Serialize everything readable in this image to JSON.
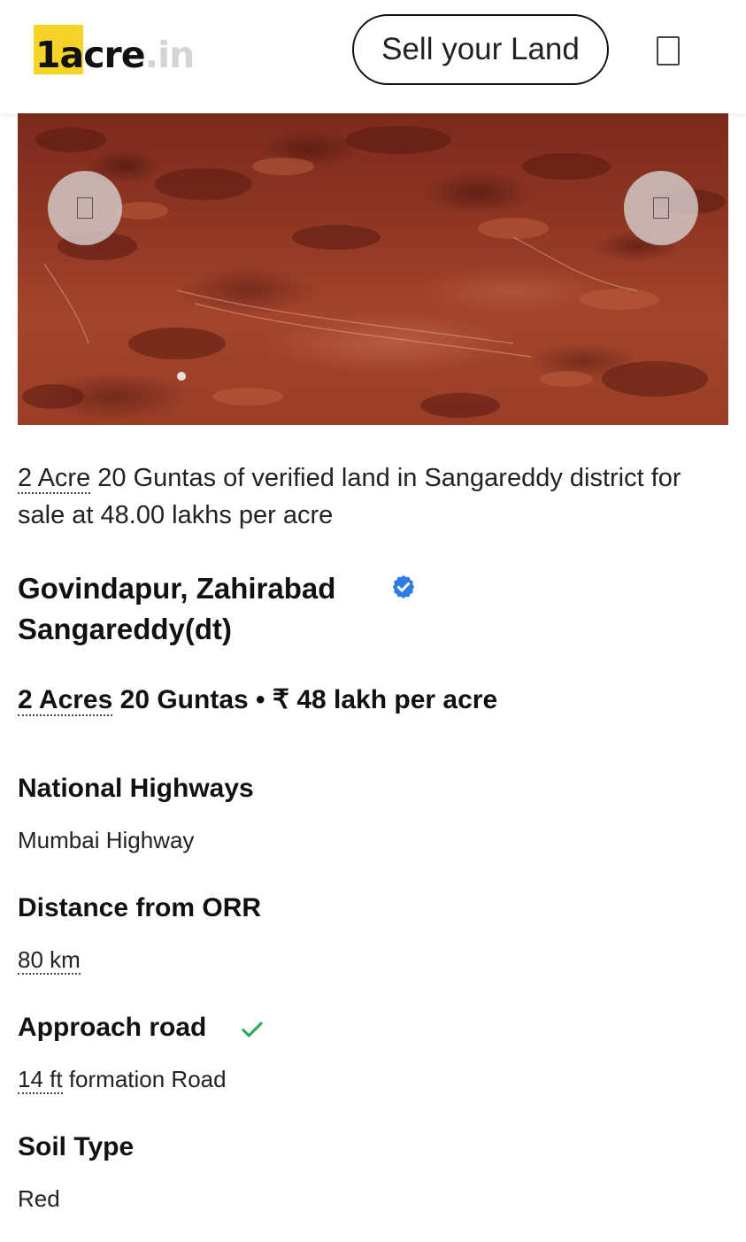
{
  "header": {
    "logo_main": "1acre",
    "logo_tld": ".in",
    "sell_button_label": "Sell your Land",
    "menu_icon": "menu-icon"
  },
  "gallery": {
    "prev_icon": "chevron-left-icon",
    "next_icon": "chevron-right-icon"
  },
  "listing": {
    "description_area": "2 Acre",
    "description_rest": " 20 Guntas of verified land in Sangareddy district for sale at 48.00 lakhs per acre",
    "location_line1": "Govindapur, Zahirabad",
    "location_line2": "Sangareddy(dt)",
    "verified_icon": "verified-badge-icon",
    "area_acres": "2 Acres",
    "area_rest": " 20 Guntas",
    "separator": " • ",
    "price": "₹ 48 lakh per acre"
  },
  "specs": {
    "national_highways": {
      "label": "National Highways",
      "value": "Mumbai Highway"
    },
    "distance_orr": {
      "label": "Distance from ORR",
      "value": "80 km"
    },
    "approach_road": {
      "label": "Approach road",
      "value_measure": "14 ft",
      "value_rest": " formation Road",
      "icon": "check-icon",
      "check_color": "#27ae60"
    },
    "soil_type": {
      "label": "Soil Type",
      "value": "Red"
    }
  },
  "colors": {
    "logo_yellow": "#f5d327",
    "verified_blue": "#2f7be5",
    "check_green": "#27ae60"
  }
}
